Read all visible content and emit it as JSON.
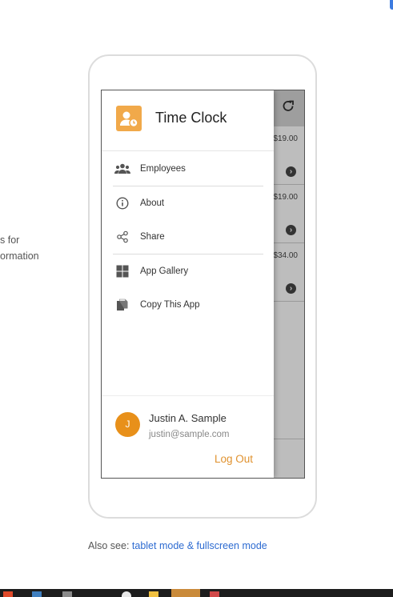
{
  "side_text": {
    "line1": "s for",
    "line2": "ormation"
  },
  "background_app": {
    "prices": [
      "$19.00",
      "$19.00",
      "$34.00"
    ],
    "refresh_icon": "refresh-icon",
    "row_icon": "chevron-circle-icon"
  },
  "drawer": {
    "app_title": "Time Clock",
    "logo_icon": "person-clock-icon",
    "menu": [
      {
        "label": "Employees",
        "icon": "people-icon"
      },
      {
        "label": "About",
        "icon": "info-icon"
      },
      {
        "label": "Share",
        "icon": "share-icon"
      },
      {
        "label": "App Gallery",
        "icon": "grid-icon"
      },
      {
        "label": "Copy This App",
        "icon": "copy-icon"
      }
    ],
    "user": {
      "initial": "J",
      "name": "Justin A. Sample",
      "email": "justin@sample.com",
      "logout_label": "Log Out"
    }
  },
  "also_see": {
    "prefix": "Also see:",
    "link_label": "tablet mode & fullscreen mode"
  },
  "colors": {
    "accent": "#e0922f",
    "logo_bg": "#f1a94a",
    "avatar_bg": "#e8901a",
    "link": "#2d6bd1"
  }
}
